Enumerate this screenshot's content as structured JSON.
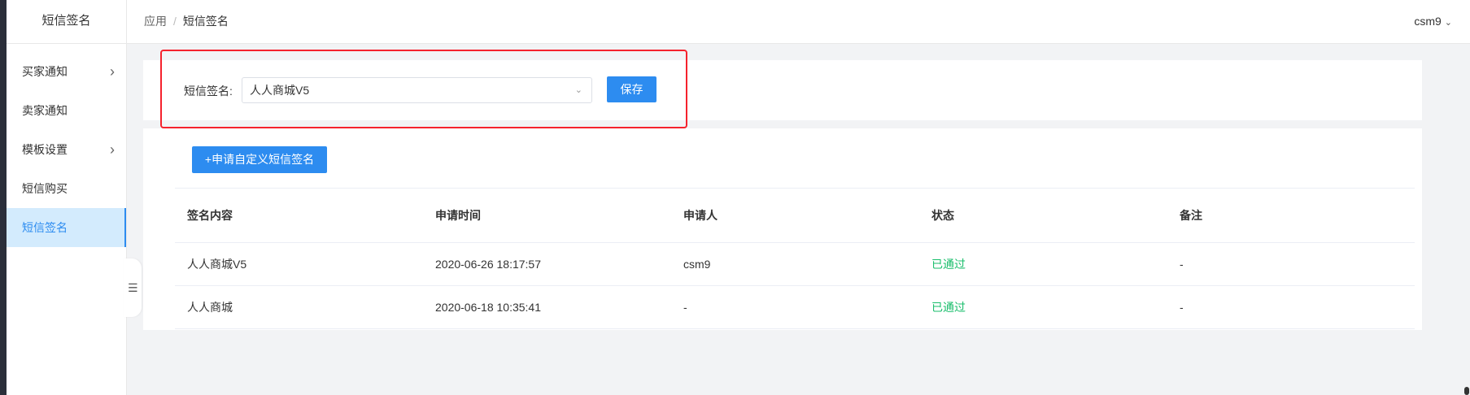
{
  "sidebar": {
    "title": "短信签名",
    "items": [
      {
        "label": "买家通知",
        "chevron": "›"
      },
      {
        "label": "卖家通知"
      },
      {
        "label": "模板设置",
        "chevron": "›"
      },
      {
        "label": "短信购买"
      },
      {
        "label": "短信签名"
      }
    ],
    "collapse_icon": "☰"
  },
  "header": {
    "breadcrumb": [
      "应用",
      "短信签名"
    ],
    "breadcrumb_sep": "/",
    "user": "csm9",
    "user_caret": "⌄"
  },
  "form": {
    "label": "短信签名:",
    "selected": "人人商城V5",
    "select_caret": "⌄",
    "save_label": "保存"
  },
  "apply_button": "+申请自定义短信签名",
  "table": {
    "columns": [
      "签名内容",
      "申请时间",
      "申请人",
      "状态",
      "备注"
    ],
    "rows": [
      [
        "人人商城V5",
        "2020-06-26 18:17:57",
        "csm9",
        "已通过",
        "-"
      ],
      [
        "人人商城",
        "2020-06-18 10:35:41",
        "-",
        "已通过",
        "-"
      ]
    ]
  },
  "colors": {
    "primary": "#2d8cf0",
    "success": "#19be6b",
    "highlight_border": "#f5222d"
  }
}
